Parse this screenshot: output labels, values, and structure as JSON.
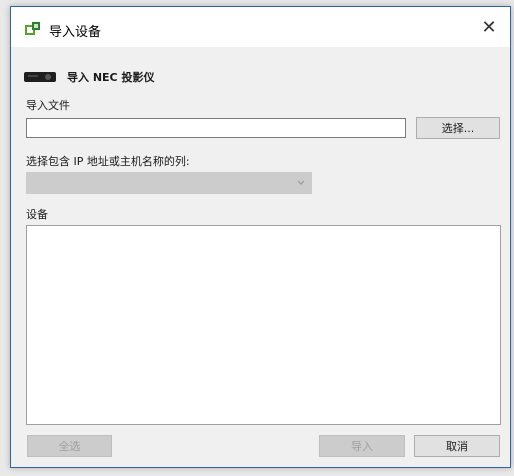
{
  "window": {
    "title": "导入设备",
    "close_symbol": "✕",
    "app_icon": "device-manager-icon"
  },
  "header": {
    "icon": "projector-icon",
    "title": "导入 NEC 投影仪"
  },
  "import_file": {
    "label": "导入文件",
    "value": "",
    "browse_label": "选择..."
  },
  "column_select": {
    "label": "选择包含 IP 地址或主机名称的列:",
    "selected": ""
  },
  "devices": {
    "label": "设备",
    "items": []
  },
  "footer": {
    "select_all_label": "全选",
    "import_label": "导入",
    "cancel_label": "取消"
  }
}
